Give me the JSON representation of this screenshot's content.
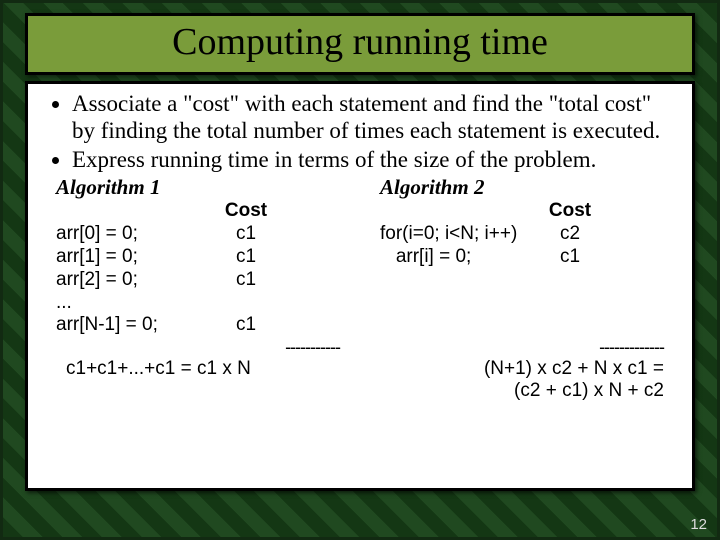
{
  "title": "Computing running time",
  "bullets": [
    "Associate a \"cost\" with each statement and find the \"total cost\"  by finding the total number of times each statement is executed.",
    "Express running time in terms of the size of the problem."
  ],
  "algo1": {
    "title": "Algorithm 1",
    "cost_header": "Cost",
    "lines": [
      {
        "stmt": "arr[0] = 0;",
        "cost": "c1"
      },
      {
        "stmt": "arr[1] = 0;",
        "cost": "c1"
      },
      {
        "stmt": "arr[2] = 0;",
        "cost": "c1"
      },
      {
        "stmt": "...",
        "cost": ""
      },
      {
        "stmt": "arr[N-1] = 0;",
        "cost": "c1"
      }
    ],
    "divider": "-----------",
    "result": "c1+c1+...+c1 = c1 x N"
  },
  "algo2": {
    "title": "Algorithm 2",
    "cost_header": "Cost",
    "lines": [
      {
        "stmt": "for(i=0; i<N; i++)",
        "cost": "c2"
      },
      {
        "stmt": "   arr[i] = 0;",
        "cost": "c1"
      }
    ],
    "divider": "-------------",
    "result_l1": "(N+1) x c2 + N x c1 =",
    "result_l2": "(c2 + c1) x N + c2"
  },
  "page_number": "12"
}
